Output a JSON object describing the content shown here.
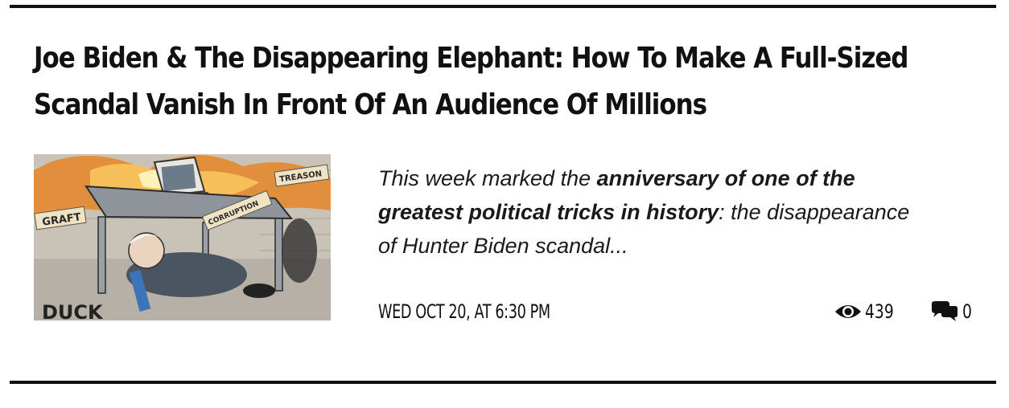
{
  "article": {
    "title_lines": [
      "Joe Biden & The Disappearing Elephant: How To Make A Full-Sized",
      "Scandal Vanish In Front Of An Audience Of Millions"
    ],
    "thumbnail": {
      "icon": "political-cartoon-image",
      "labels": {
        "graft": "GRAFT",
        "treason": "TREASON",
        "corruption": "CORRUPTION",
        "duck": "DUCK"
      }
    },
    "excerpt": {
      "line1_plain": "This week marked the ",
      "line1_bold": "anniversary of one of the",
      "line2_bold": "greatest political tricks in history",
      "line2_plain": ": the disappearance",
      "line3_plain": "of Hunter Biden scandal..."
    },
    "date": "WED OCT 20, AT 6:30 PM",
    "views": {
      "icon": "eye-icon",
      "count": "439"
    },
    "comments": {
      "icon": "comments-icon",
      "count": "0"
    }
  },
  "colors": {
    "text": "#111111",
    "rule": "#111111",
    "background": "#ffffff"
  }
}
